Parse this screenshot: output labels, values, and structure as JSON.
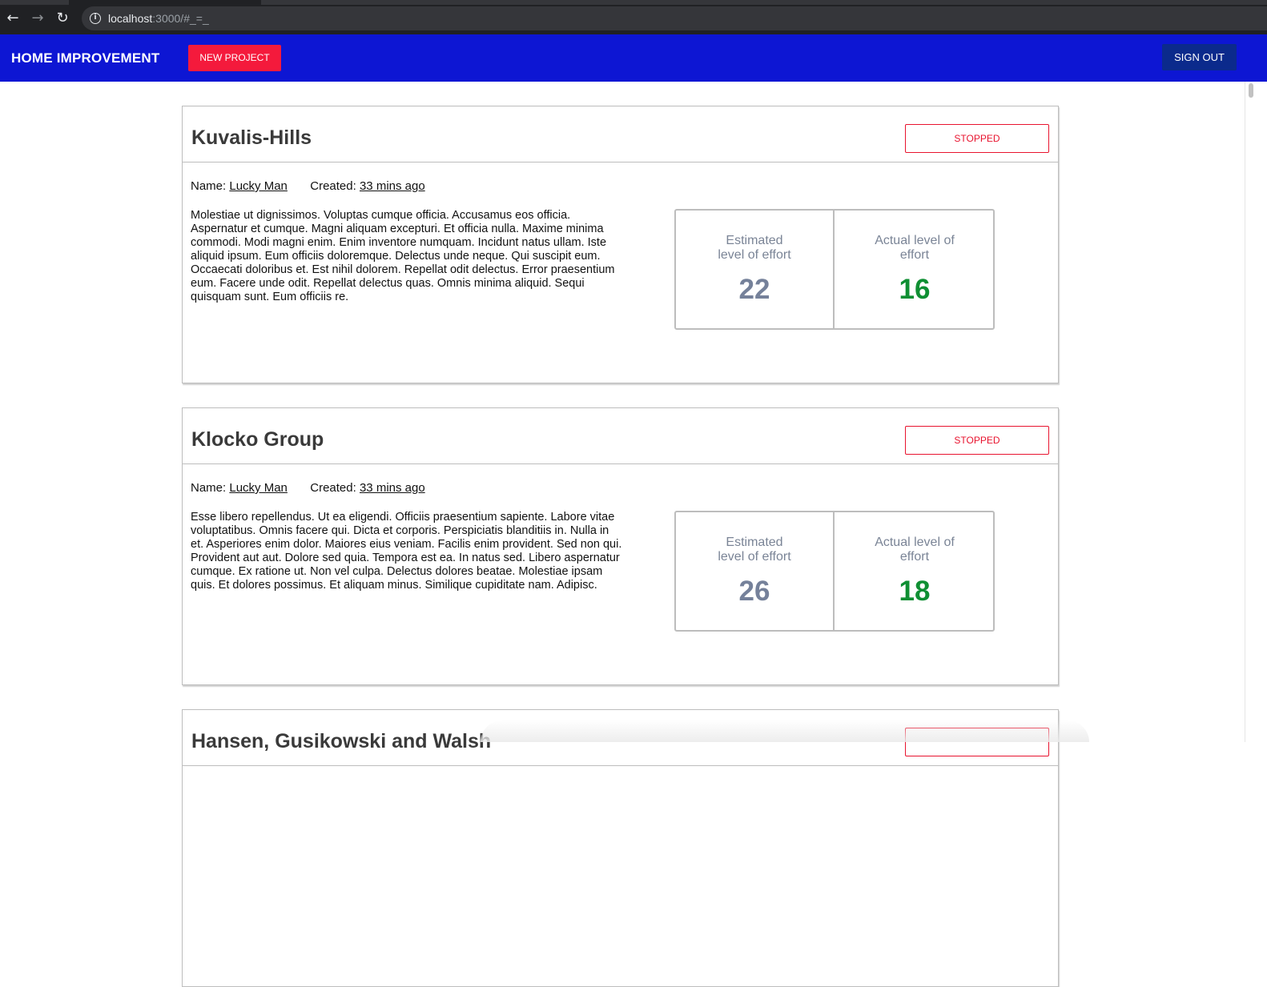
{
  "browser": {
    "url_host": "localhost",
    "url_rest": ":3000/#_=_",
    "back_icon": "arrow-left-icon",
    "forward_icon": "arrow-right-icon",
    "reload_icon": "reload-icon",
    "info_icon": "info-icon"
  },
  "header": {
    "brand": "HOME IMPROVEMENT",
    "new_project_label": "NEW PROJECT",
    "sign_out_label": "SIGN OUT",
    "bg_color": "#0d16d3",
    "accent_color": "#f41a3c"
  },
  "projects": [
    {
      "title": "Kuvalis-Hills",
      "status": "STOPPED",
      "name_label": "Name:",
      "name_value": "Lucky Man",
      "created_label": "Created:",
      "created_value": "33 mins ago",
      "description": "Molestiae ut dignissimos. Voluptas cumque officia. Accusamus eos officia. Aspernatur et cumque. Magni aliquam excepturi. Et officia nulla. Maxime minima commodi. Modi magni enim. Enim inventore numquam. Incidunt natus ullam. Iste aliquid ipsum. Eum officiis doloremque. Delectus unde neque. Qui suscipit eum. Occaecati doloribus et. Est nihil dolorem. Repellat odit delectus. Error praesentium eum. Facere unde odit. Repellat delectus quas. Omnis minima aliquid. Sequi quisquam sunt. Eum officiis re.",
      "estimated_label": "Estimated level of effort",
      "estimated_value": "22",
      "actual_label": "Actual level of effort",
      "actual_value": "16"
    },
    {
      "title": "Klocko Group",
      "status": "STOPPED",
      "name_label": "Name:",
      "name_value": "Lucky Man",
      "created_label": "Created:",
      "created_value": "33 mins ago",
      "description": "Esse libero repellendus. Ut ea eligendi. Officiis praesentium sapiente. Labore vitae voluptatibus. Omnis facere qui. Dicta et corporis. Perspiciatis blanditiis in. Nulla in et. Asperiores enim dolor. Maiores eius veniam. Facilis enim provident. Sed non qui. Provident aut aut. Dolore sed quia. Tempora est ea. In natus sed. Libero aspernatur cumque. Ex ratione ut. Non vel culpa. Delectus dolores beatae. Molestiae ipsam quis. Et dolores possimus. Et aliquam minus. Similique cupiditate nam. Adipisc.",
      "estimated_label": "Estimated level of effort",
      "estimated_value": "26",
      "actual_label": "Actual level of effort",
      "actual_value": "18"
    },
    {
      "title": "Hansen, Gusikowski and Walsh"
    }
  ]
}
